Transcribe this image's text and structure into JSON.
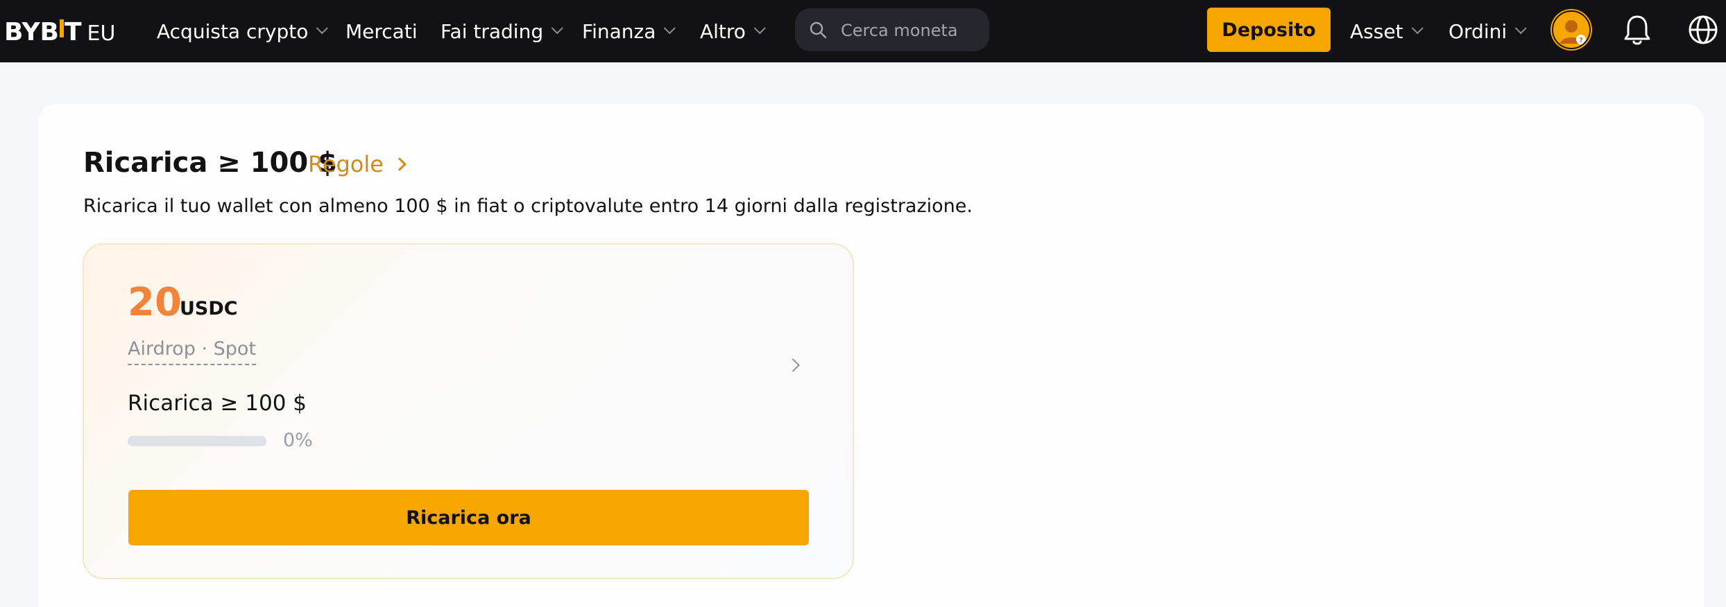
{
  "header": {
    "logo_text": "BYB",
    "logo_text_end": "T",
    "logo_region": "EU",
    "nav": [
      {
        "label": "Acquista crypto",
        "has_dropdown": true
      },
      {
        "label": "Mercati",
        "has_dropdown": false
      },
      {
        "label": "Fai trading",
        "has_dropdown": true
      },
      {
        "label": "Finanza",
        "has_dropdown": true
      },
      {
        "label": "Altro",
        "has_dropdown": true
      }
    ],
    "search_placeholder": "Cerca moneta",
    "deposit_label": "Deposito",
    "assets_label": "Asset",
    "orders_label": "Ordini",
    "icons": [
      "search-icon",
      "avatar",
      "bell-icon",
      "globe-icon"
    ]
  },
  "section": {
    "title": "Ricarica ≥ 100 $",
    "rules_label": "Regole",
    "description": "Ricarica il tuo wallet con almeno 100 $ in fiat o criptovalute entro 14 giorni dalla registrazione."
  },
  "task": {
    "reward_amount": "20",
    "reward_currency": "USDC",
    "reward_type": "Airdrop · Spot",
    "title": "Ricarica ≥ 100 $",
    "progress": 0,
    "progress_text": "0%",
    "cta_label": "Ricarica ora"
  },
  "colors": {
    "accent": "#f7a600",
    "reward": "#f2843a",
    "link": "#d28a19",
    "topbar": "#121214"
  }
}
